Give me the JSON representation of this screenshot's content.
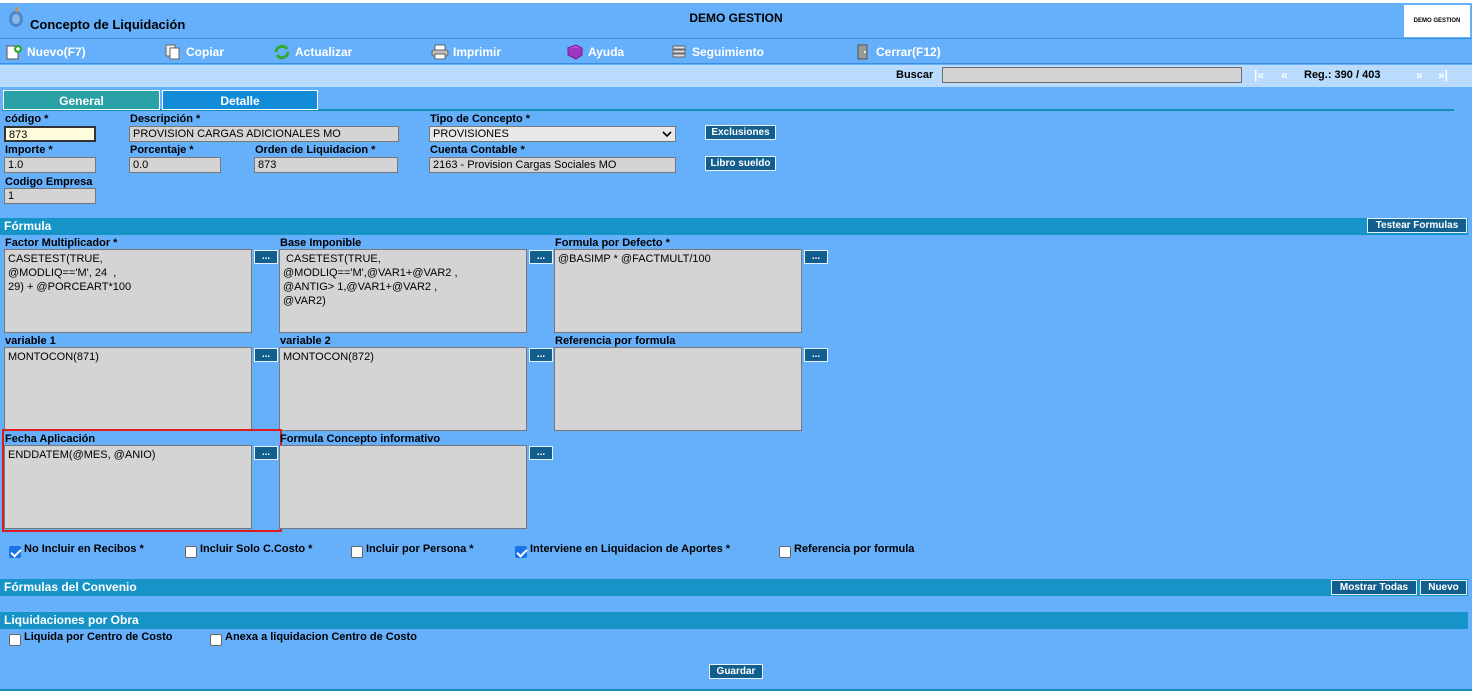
{
  "window": {
    "title": "Concepto de Liquidación",
    "company": "DEMO GESTION",
    "company_logo_text": "DEMO GESTION"
  },
  "toolbar": {
    "new": "Nuevo(F7)",
    "copy": "Copiar",
    "update": "Actualizar",
    "print": "Imprimir",
    "help": "Ayuda",
    "tracking": "Seguimiento",
    "close": "Cerrar(F12)"
  },
  "nav": {
    "search_label": "Buscar",
    "search_value": "",
    "first": "|«",
    "prev": "«",
    "record": "Reg.: 390 / 403",
    "next": "»",
    "last": "»|"
  },
  "tabs": {
    "general": "General",
    "detail": "Detalle"
  },
  "form": {
    "codigo_label": "código *",
    "codigo_value": "873",
    "descripcion_label": "Descripción *",
    "descripcion_value": "PROVISION CARGAS ADICIONALES MO",
    "tipo_label": "Tipo de Concepto *",
    "tipo_value": "PROVISIONES",
    "exclusiones_button": "Exclusiones",
    "importe_label": "Importe *",
    "importe_value": "1.0",
    "porcentaje_label": "Porcentaje *",
    "porcentaje_value": "0.0",
    "orden_label": "Orden de Liquidacion *",
    "orden_value": "873",
    "cuenta_label": "Cuenta Contable *",
    "cuenta_value": "2163 - Provision Cargas Sociales MO",
    "libro_button": "Libro sueldo",
    "empresa_label": "Codigo Empresa",
    "empresa_value": "1"
  },
  "formula": {
    "section_title": "Fórmula",
    "test_button": "Testear Formulas",
    "dots": "...",
    "factor_label": "Factor Multiplicador *",
    "factor_value": "CASETEST(TRUE,\n@MODLIQ=='M', 24  ,\n29) + @PORCEART*100",
    "base_label": "Base Imponible",
    "base_value": " CASETEST(TRUE,\n@MODLIQ=='M',@VAR1+@VAR2 ,\n@ANTIG> 1,@VAR1+@VAR2 ,\n@VAR2)",
    "defecto_label": "Formula por Defecto *",
    "defecto_value": "@BASIMP * @FACTMULT/100",
    "var1_label": "variable 1",
    "var1_value": "MONTOCON(871)",
    "var2_label": "variable 2",
    "var2_value": "MONTOCON(872)",
    "referencia_label": "Referencia por formula",
    "referencia_value": "",
    "fecha_label": "Fecha Aplicación",
    "fecha_value": "ENDDATEM(@MES, @ANIO)",
    "informativo_label": "Formula Concepto informativo",
    "informativo_value": ""
  },
  "checks": {
    "no_incluir": "No Incluir en Recibos *",
    "solo_ccosto": "Incluir Solo C.Costo *",
    "por_persona": "Incluir por Persona *",
    "interviene": "Interviene en Liquidacion de Aportes *",
    "referencia": "Referencia por formula"
  },
  "convenio": {
    "section_title": "Fórmulas del Convenio",
    "show_all": "Mostrar Todas",
    "new": "Nuevo"
  },
  "obra": {
    "section_title": "Liquidaciones por Obra",
    "liquida": "Liquida por Centro de Costo",
    "anexa": "Anexa a liquidacion Centro de Costo",
    "save": "Guardar"
  }
}
